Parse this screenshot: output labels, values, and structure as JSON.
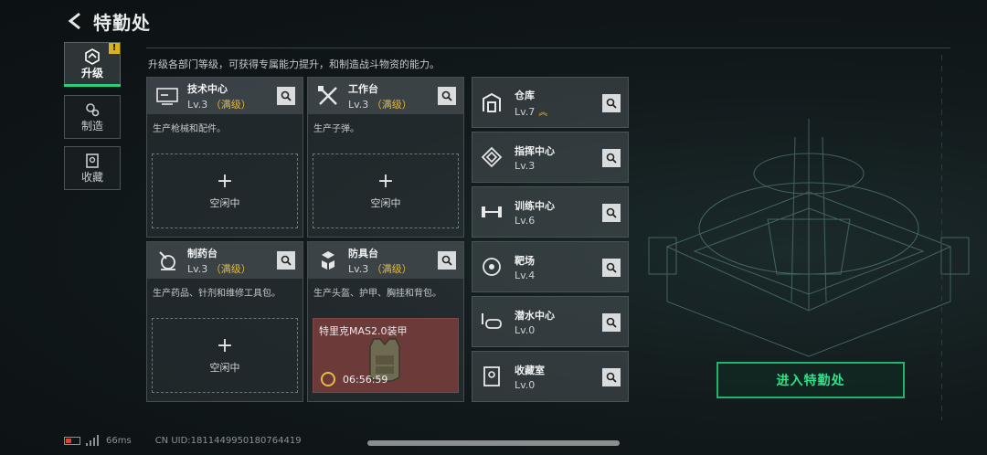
{
  "header": {
    "title": "特勤处"
  },
  "sidebar": {
    "tabs": [
      {
        "label": "升级",
        "icon": "upgrade-icon",
        "active": true,
        "badge": "!"
      },
      {
        "label": "制造",
        "icon": "gears-icon",
        "active": false
      },
      {
        "label": "收藏",
        "icon": "collection-icon",
        "active": false
      }
    ]
  },
  "intro": "升级各部门等级，可获得专属能力提升，和制造战斗物资的能力。",
  "facilities": [
    {
      "name": "技术中心",
      "level": "Lv.3",
      "status": "（满级）",
      "desc": "生产枪械和配件。",
      "slot_plus": "+",
      "slot_label": "空闲中",
      "icon": "tech-center-icon"
    },
    {
      "name": "工作台",
      "level": "Lv.3",
      "status": "（满级）",
      "desc": "生产子弹。",
      "slot_plus": "+",
      "slot_label": "空闲中",
      "icon": "workbench-icon"
    },
    {
      "name": "制药台",
      "level": "Lv.3",
      "status": "（满级）",
      "desc": "生产药品、针剂和维修工具包。",
      "slot_plus": "+",
      "slot_label": "空闲中",
      "icon": "pharmacy-icon"
    },
    {
      "name": "防具台",
      "level": "Lv.3",
      "status": "（满级）",
      "desc": "生产头盔、护甲、胸挂和背包。",
      "craft_item": "特里克MAS2.0装甲",
      "craft_timer": "06:56:59",
      "icon": "armor-bench-icon"
    }
  ],
  "small_facilities": [
    {
      "name": "仓库",
      "level": "Lv.7",
      "upgradable": true,
      "icon": "warehouse-icon"
    },
    {
      "name": "指挥中心",
      "level": "Lv.3",
      "icon": "command-center-icon"
    },
    {
      "name": "训练中心",
      "level": "Lv.6",
      "icon": "training-center-icon"
    },
    {
      "name": "靶场",
      "level": "Lv.4",
      "icon": "shooting-range-icon"
    },
    {
      "name": "潜水中心",
      "level": "Lv.0",
      "icon": "diving-center-icon"
    },
    {
      "name": "收藏室",
      "level": "Lv.0",
      "icon": "collection-room-icon"
    }
  ],
  "enter_button": "进入特勤处",
  "status_bar": {
    "ping": "66ms",
    "uid": "CN UID:1811449950180764419"
  },
  "colors": {
    "accent_green": "#27d07c",
    "max_gold": "#e3b93a",
    "badge_yellow": "#d8b320",
    "craft_red": "#6b3a39"
  }
}
